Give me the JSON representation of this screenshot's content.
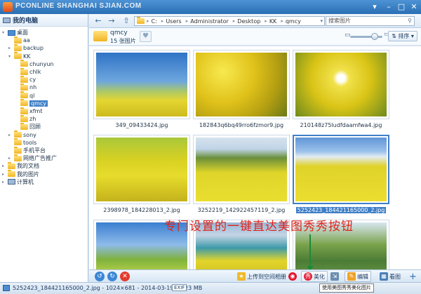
{
  "window": {
    "watermark": "PCONLINE  SHANGHAI  SJIAN.COM",
    "menu_glyph": "▾",
    "min_glyph": "–",
    "max_glyph": "□",
    "close_glyph": "✕"
  },
  "sidebar": {
    "title": "我的电脑",
    "tree": [
      {
        "label": "桌面",
        "icon": "desktop-icon",
        "depth": 0,
        "expander": "▾"
      },
      {
        "label": "aa",
        "icon": "folder-icon",
        "depth": 1,
        "expander": ""
      },
      {
        "label": "backup",
        "icon": "folder-icon",
        "depth": 1,
        "expander": "▸"
      },
      {
        "label": "KK",
        "icon": "folder-icon",
        "depth": 1,
        "expander": "▾"
      },
      {
        "label": "chunyun",
        "icon": "folder-icon",
        "depth": 2,
        "expander": ""
      },
      {
        "label": "chlk",
        "icon": "folder-icon",
        "depth": 2,
        "expander": ""
      },
      {
        "label": "cy",
        "icon": "folder-icon",
        "depth": 2,
        "expander": ""
      },
      {
        "label": "nh",
        "icon": "folder-icon",
        "depth": 2,
        "expander": ""
      },
      {
        "label": "ql",
        "icon": "folder-icon",
        "depth": 2,
        "expander": ""
      },
      {
        "label": "qmcy",
        "icon": "folder-icon",
        "depth": 2,
        "expander": "",
        "selected": true
      },
      {
        "label": "xfmt",
        "icon": "folder-icon",
        "depth": 2,
        "expander": ""
      },
      {
        "label": "zh",
        "icon": "folder-icon",
        "depth": 2,
        "expander": ""
      },
      {
        "label": "回顾",
        "icon": "folder-icon",
        "depth": 2,
        "expander": ""
      },
      {
        "label": "sony",
        "icon": "folder-icon",
        "depth": 1,
        "expander": "▸"
      },
      {
        "label": "tools",
        "icon": "folder-icon",
        "depth": 1,
        "expander": ""
      },
      {
        "label": "手机平台",
        "icon": "folder-icon",
        "depth": 1,
        "expander": ""
      },
      {
        "label": "网络广告推广",
        "icon": "folder-icon",
        "depth": 1,
        "expander": "▸"
      },
      {
        "label": "我的文档",
        "icon": "folder-icon",
        "depth": 0,
        "expander": "▸"
      },
      {
        "label": "我的图片",
        "icon": "folder-icon",
        "depth": 0,
        "expander": "▸"
      },
      {
        "label": "计算机",
        "icon": "computer-icon",
        "depth": 0,
        "expander": "▸"
      }
    ]
  },
  "toolbar": {
    "back_glyph": "←",
    "forward_glyph": "→",
    "up_glyph": "⇧",
    "path": [
      "C:",
      "Users",
      "Administrator",
      "Desktop",
      "KK",
      "qmcy"
    ],
    "path_sep": "▸",
    "dropdown_glyph": "▾",
    "search_placeholder": "搜索图片",
    "search_glyph": "⚲"
  },
  "folder": {
    "name": "qmcy",
    "count": "15 张图片",
    "heart_glyph": "♥",
    "zoom_out": "▭",
    "zoom_in": "▭",
    "zoom_level": 0.75,
    "sort_label": "⇅ 排序 ▾"
  },
  "images": [
    {
      "name": "349_09433424.jpg",
      "style": "a"
    },
    {
      "name": "182843q6bq49rro6fzmor9.jpg",
      "style": "b"
    },
    {
      "name": "210148z75ludfdaamfwa4.jpg",
      "style": "c"
    },
    {
      "name": "2398978_184228013_2.jpg",
      "style": "d"
    },
    {
      "name": "3252219_142922457119_2.jpg",
      "style": "e"
    },
    {
      "name": "5252423_184421165000_2.jpg",
      "style": "f",
      "selected": true
    },
    {
      "name": "",
      "style": "g"
    },
    {
      "name": "",
      "style": "h"
    },
    {
      "name": "",
      "style": "i"
    }
  ],
  "annotation": "专门设置的一键直达美图秀秀按钮",
  "actions": {
    "rotate_left": "↺",
    "rotate_right": "↻",
    "delete": "✕",
    "upload": "上传到空间相册",
    "weibo": "◉",
    "meitu": "美化",
    "edit": "编辑",
    "view": "看图",
    "add": "+",
    "meitu_badge": "秀",
    "upload_badge": "★",
    "edit_badge": "✎",
    "view_badge": "▦",
    "extra_badge": "⇲"
  },
  "tooltip": "使用美图秀秀美化图片",
  "status": {
    "text": "5252423_184421165000_2.jpg - 1024×681 - 2014-03-19 - 1.23 MB",
    "exif": "EXIF"
  }
}
